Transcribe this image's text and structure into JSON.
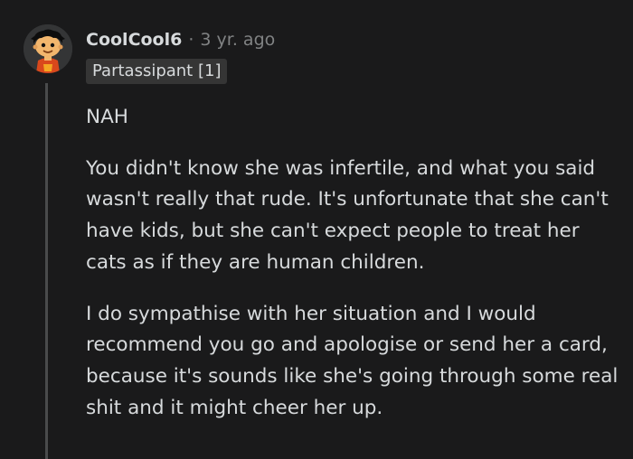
{
  "comment": {
    "username": "CoolCool6",
    "separator": "·",
    "timestamp": "3 yr. ago",
    "flair": "Partassipant [1]",
    "paragraphs": [
      "NAH",
      "You didn't know she was infertile, and what you said wasn't really that rude. It's unfortunate that she can't have kids, but she can't expect people to treat her cats as if they are human children.",
      "I do sympathise with her situation and I would recommend you go and apologise or send her a card, because it's sounds like she's going through some real shit and it might cheer her up."
    ]
  },
  "colors": {
    "background": "#1a1a1b",
    "text": "#d7dadc",
    "meta": "#818384",
    "flair_bg": "#353535",
    "thread_line": "#4a4b4c"
  }
}
